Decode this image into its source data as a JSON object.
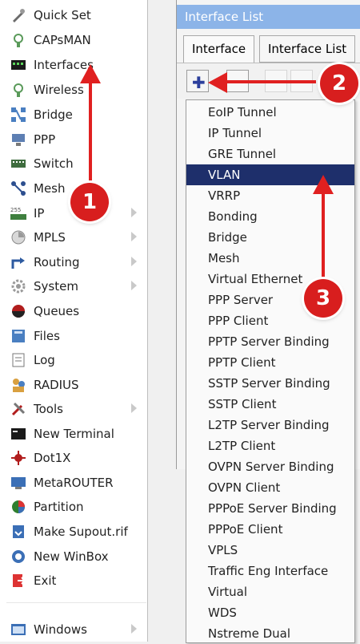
{
  "sidebar": {
    "items": [
      {
        "label": "Quick Set",
        "icon": "quick-set-icon"
      },
      {
        "label": "CAPsMAN",
        "icon": "capsman-icon"
      },
      {
        "label": "Interfaces",
        "icon": "interfaces-icon"
      },
      {
        "label": "Wireless",
        "icon": "wireless-icon"
      },
      {
        "label": "Bridge",
        "icon": "bridge-icon"
      },
      {
        "label": "PPP",
        "icon": "ppp-icon"
      },
      {
        "label": "Switch",
        "icon": "switch-icon"
      },
      {
        "label": "Mesh",
        "icon": "mesh-icon"
      },
      {
        "label": "IP",
        "icon": "ip-icon",
        "submenu": true
      },
      {
        "label": "MPLS",
        "icon": "mpls-icon",
        "submenu": true
      },
      {
        "label": "Routing",
        "icon": "routing-icon",
        "submenu": true
      },
      {
        "label": "System",
        "icon": "system-icon",
        "submenu": true
      },
      {
        "label": "Queues",
        "icon": "queues-icon"
      },
      {
        "label": "Files",
        "icon": "files-icon"
      },
      {
        "label": "Log",
        "icon": "log-icon"
      },
      {
        "label": "RADIUS",
        "icon": "radius-icon"
      },
      {
        "label": "Tools",
        "icon": "tools-icon",
        "submenu": true
      },
      {
        "label": "New Terminal",
        "icon": "terminal-icon"
      },
      {
        "label": "Dot1X",
        "icon": "dot1x-icon"
      },
      {
        "label": "MetaROUTER",
        "icon": "metarouter-icon"
      },
      {
        "label": "Partition",
        "icon": "partition-icon"
      },
      {
        "label": "Make Supout.rif",
        "icon": "supout-icon"
      },
      {
        "label": "New WinBox",
        "icon": "winbox-icon"
      },
      {
        "label": "Exit",
        "icon": "exit-icon"
      }
    ],
    "windows_label": "Windows"
  },
  "window": {
    "title": "Interface List",
    "tabs": [
      "Interface",
      "Interface List"
    ]
  },
  "menu": {
    "items": [
      "EoIP Tunnel",
      "IP Tunnel",
      "GRE Tunnel",
      "VLAN",
      "VRRP",
      "Bonding",
      "Bridge",
      "Mesh",
      "Virtual Ethernet",
      "PPP Server",
      "PPP Client",
      "PPTP Server Binding",
      "PPTP Client",
      "SSTP Server Binding",
      "SSTP Client",
      "L2TP Server Binding",
      "L2TP Client",
      "OVPN Server Binding",
      "OVPN Client",
      "PPPoE Server Binding",
      "PPPoE Client",
      "VPLS",
      "Traffic Eng Interface",
      "Virtual",
      "WDS",
      "Nstreme Dual"
    ],
    "selected": "VLAN"
  },
  "badges": [
    "1",
    "2",
    "3"
  ],
  "colors": {
    "accent": "#1e2f6b",
    "badge": "#d81e1e",
    "title": "#8cb4e8"
  }
}
